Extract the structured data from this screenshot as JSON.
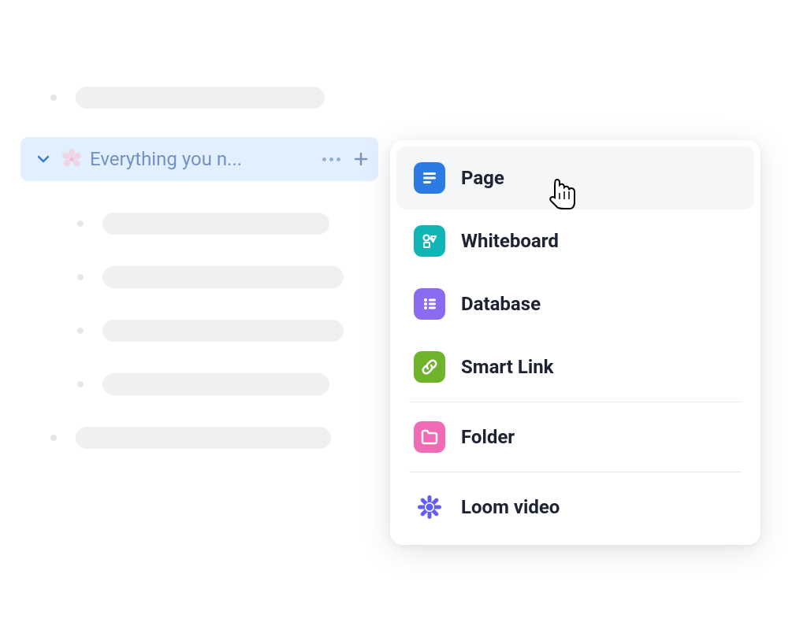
{
  "sidebar": {
    "active_item": {
      "title": "Everything you n...",
      "icon": "cherry-blossom"
    }
  },
  "create_menu": {
    "items": [
      {
        "label": "Page",
        "icon": "page-icon",
        "hovered": true
      },
      {
        "label": "Whiteboard",
        "icon": "whiteboard-icon",
        "hovered": false
      },
      {
        "label": "Database",
        "icon": "database-icon",
        "hovered": false
      },
      {
        "label": "Smart Link",
        "icon": "smart-link-icon",
        "hovered": false
      },
      {
        "label": "Folder",
        "icon": "folder-icon",
        "hovered": false
      },
      {
        "label": "Loom video",
        "icon": "loom-icon",
        "hovered": false
      }
    ]
  }
}
